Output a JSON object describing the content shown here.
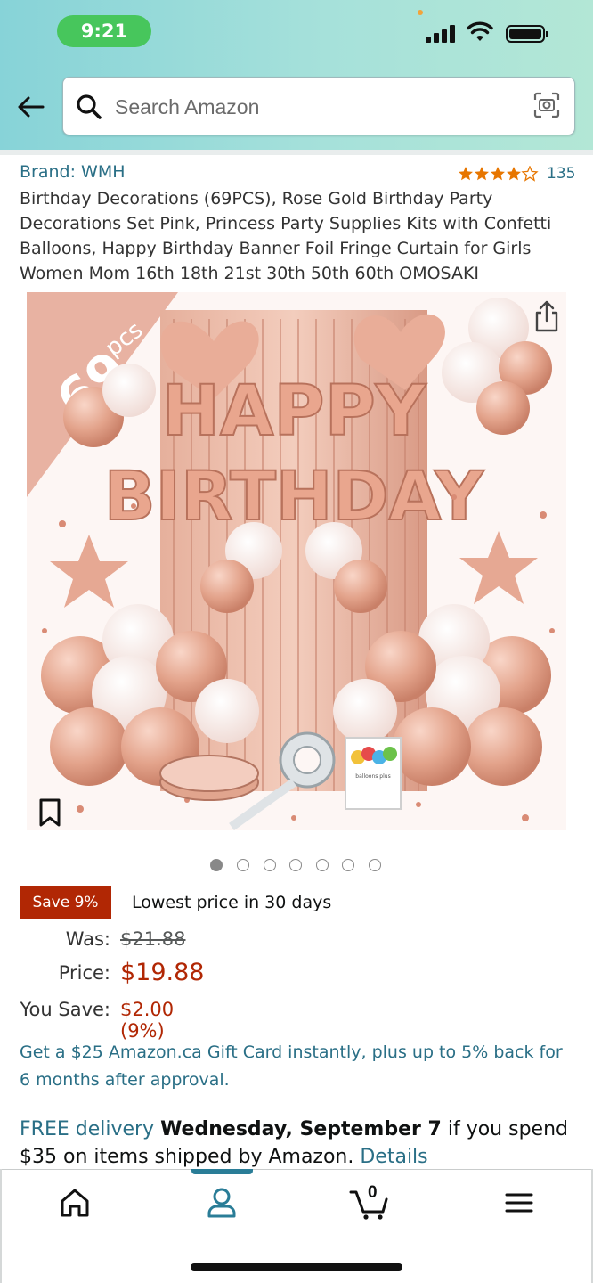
{
  "status_bar": {
    "time": "9:21"
  },
  "search": {
    "placeholder": "Search Amazon"
  },
  "product": {
    "brand": "Brand: WMH",
    "rating_stars": 4.5,
    "rating_count": "135",
    "title": "Birthday Decorations (69PCS), Rose Gold Birthday Party Decorations Set Pink, Princess Party Supplies Kits with Confetti Balloons, Happy Birthday Banner Foil Fringe Curtain for Girls Women Mom 16th 18th 21st 30th 50th 60th OMOSAKI"
  },
  "image": {
    "badge_count": "69",
    "badge_unit": "pcs",
    "banner_line1": "HAPPY",
    "banner_line2": "BIRTHDAY",
    "package_text": "balloons plus",
    "carousel_count": 7,
    "carousel_active": 0
  },
  "pricing": {
    "save_badge": "Save 9%",
    "lowest_note": "Lowest price in 30 days",
    "was_label": "Was:",
    "was_value": "$21.88",
    "price_label": "Price:",
    "price_value": "$19.88",
    "you_save_label": "You Save:",
    "you_save_value": "$2.00 (9%)"
  },
  "promo": {
    "gift_card_text": "Get a $25 Amazon.ca Gift Card instantly, plus up to 5% back for 6 months after approval."
  },
  "delivery": {
    "free_delivery": "FREE delivery",
    "date": "Wednesday, September 7",
    "condition": " if you spend $35 on items shipped by Amazon. ",
    "details_link": "Details"
  },
  "bottom_nav": {
    "cart_count": "0",
    "items": [
      "home-icon",
      "account-icon",
      "cart-icon",
      "menu-icon"
    ],
    "active_index": 1
  },
  "colors": {
    "header_gradient_start": "#87d3d8",
    "header_gradient_end": "#b3e7d6",
    "link": "#2a6f86",
    "price_red": "#b12704",
    "star": "#e77600",
    "active_nav": "#2a7d97"
  }
}
